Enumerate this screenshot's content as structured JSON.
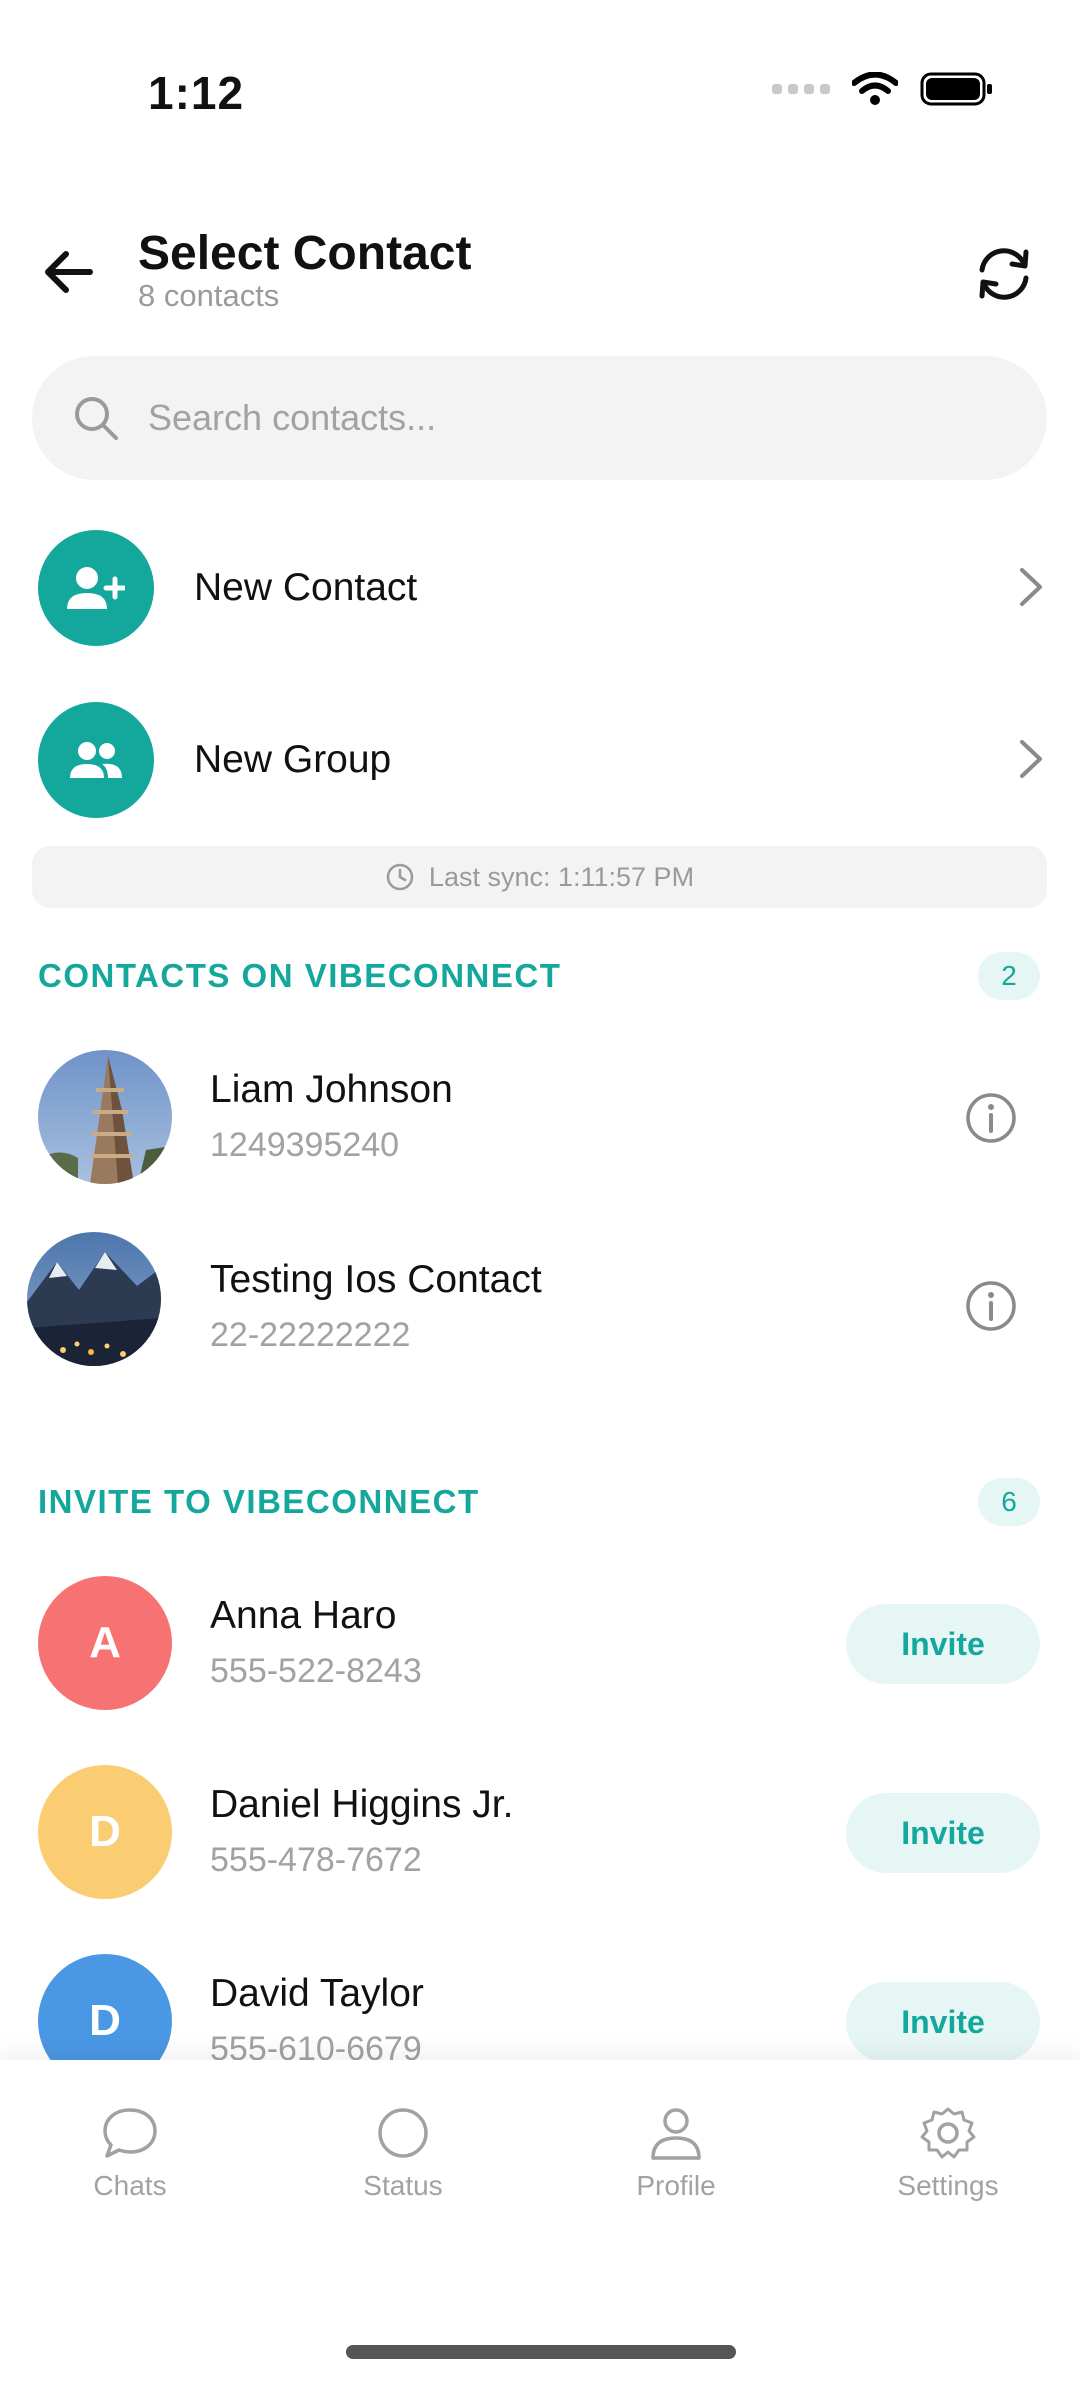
{
  "status_bar": {
    "time": "1:12"
  },
  "header": {
    "title": "Select Contact",
    "subtitle": "8 contacts"
  },
  "search": {
    "placeholder": "Search contacts..."
  },
  "actions": [
    {
      "label": "New Contact",
      "icon": "person-add-icon"
    },
    {
      "label": "New Group",
      "icon": "group-icon"
    }
  ],
  "sync": {
    "text": "Last sync: 1:11:57 PM"
  },
  "sections": {
    "on_app": {
      "title": "CONTACTS ON VIBECONNECT",
      "count": "2"
    },
    "invite": {
      "title": "INVITE TO VIBECONNECT",
      "count": "6"
    }
  },
  "contacts_on_app": [
    {
      "name": "Liam Johnson",
      "phone": "1249395240"
    },
    {
      "name": "Testing Ios Contact",
      "phone": "22-22222222"
    }
  ],
  "contacts_invite": [
    {
      "initial": "A",
      "name": "Anna Haro",
      "phone": "555-522-8243",
      "color": "#f77373",
      "action": "Invite"
    },
    {
      "initial": "D",
      "name": "Daniel Higgins Jr.",
      "phone": "555-478-7672",
      "color": "#fbcd72",
      "action": "Invite"
    },
    {
      "initial": "D",
      "name": "David Taylor",
      "phone": "555-610-6679",
      "color": "#4a97e4",
      "action": "Invite"
    }
  ],
  "tabs": [
    {
      "label": "Chats",
      "icon": "chat-icon"
    },
    {
      "label": "Status",
      "icon": "status-icon"
    },
    {
      "label": "Profile",
      "icon": "profile-icon"
    },
    {
      "label": "Settings",
      "icon": "settings-icon"
    }
  ],
  "colors": {
    "accent": "#14a89c",
    "accent_soft": "#e6f6f4",
    "muted": "#a2a2a2"
  }
}
